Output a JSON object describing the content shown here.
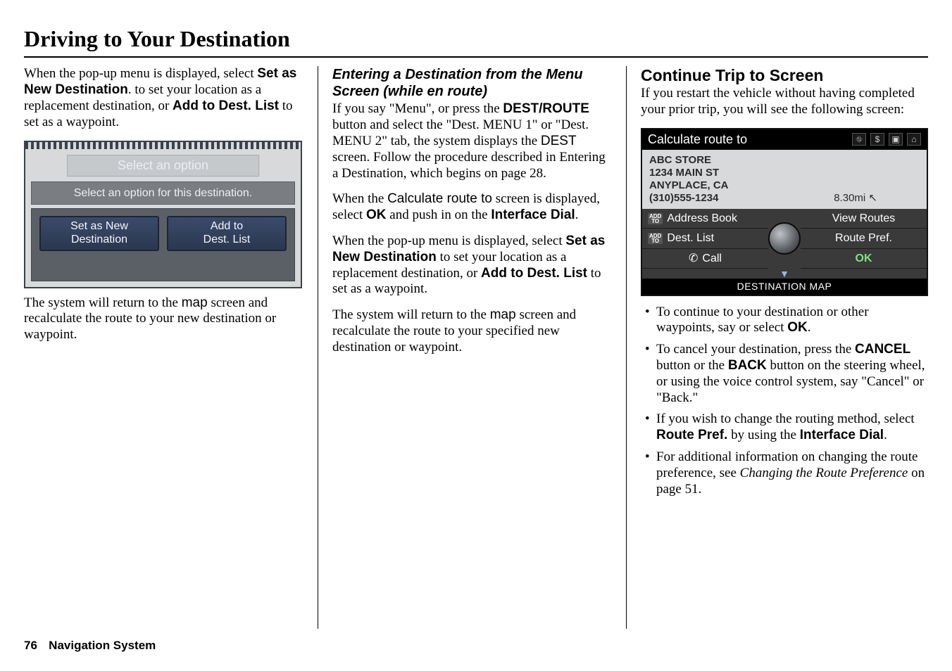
{
  "pageTitle": "Driving to Your Destination",
  "col1": {
    "p1_a": "When the pop-up menu is displayed, select ",
    "p1_b": "Set as New Destination",
    "p1_c": ". to set your location as a replacement destination, or ",
    "p1_d": "Add to Dest. List",
    "p1_e": " to set as a waypoint.",
    "ss": {
      "title": "Select an option",
      "subtitle": "Select an option for this destination.",
      "btn1": "Set as New\nDestination",
      "btn2": "Add to\nDest. List"
    },
    "p2_a": "The system will return to the ",
    "p2_b": "map",
    "p2_c": " screen and recalculate the route to your new destination or waypoint."
  },
  "col2": {
    "head": "Entering a Destination from the Menu Screen (while en route)",
    "p1_a": "If you say \"Menu\", or press the ",
    "p1_b": "DEST/ROUTE",
    "p1_c": " button and select the \"Dest. MENU 1\" or \"Dest. MENU 2\" tab, the system displays the ",
    "p1_d": "DEST",
    "p1_e": " screen. Follow the procedure described in Entering a Destination, which begins on page 28.",
    "p2_a": "When the ",
    "p2_b": "Calculate route to",
    "p2_c": " screen is displayed, select ",
    "p2_d": "OK",
    "p2_e": " and push in on the ",
    "p2_f": "Interface Dial",
    "p2_g": ".",
    "p3_a": "When the pop-up menu is displayed, select ",
    "p3_b": "Set as New Destination",
    "p3_c": " to set your location as a replacement destination, or ",
    "p3_d": "Add to Dest. List",
    "p3_e": " to set as a waypoint.",
    "p4_a": "The system will return to the ",
    "p4_b": "map",
    "p4_c": " screen and recalculate the route to your specified new destination or waypoint."
  },
  "col3": {
    "head": "Continue Trip to Screen",
    "p1": "If you restart the vehicle without having completed your prior trip, you will see the following screen:",
    "ss": {
      "title": "Calculate route to",
      "name": "ABC STORE",
      "addr1": "1234 MAIN ST",
      "addr2": "ANYPLACE, CA",
      "phone": "(310)555-1234",
      "distance": "8.30mi",
      "left1_badge": "ADD\nTO",
      "left1": "Address Book",
      "left2_badge": "ADD\nTO",
      "left2": "Dest. List",
      "left3_icon": "✆",
      "left3": "Call",
      "right1": "View Routes",
      "right2": "Route Pref.",
      "right3": "OK",
      "arrow": "▼",
      "footer": "DESTINATION MAP"
    },
    "b1_a": "To continue to your destination or other waypoints, say or select ",
    "b1_b": "OK",
    "b1_c": ".",
    "b2_a": "To cancel your destination, press the ",
    "b2_b": "CANCEL",
    "b2_c": " button or the ",
    "b2_d": "BACK",
    "b2_e": " button on the steering wheel, or using the voice control system, say \"Cancel\" or \"Back.\"",
    "b3_a": "If you wish to change the routing method, select ",
    "b3_b": "Route Pref.",
    "b3_c": " by using the ",
    "b3_d": "Interface Dial",
    "b3_e": ".",
    "b4_a": "For additional information on changing the route preference, see ",
    "b4_b": "Changing the Route Preference",
    "b4_c": " on page 51."
  },
  "footer": {
    "page": "76",
    "section": "Navigation System"
  }
}
